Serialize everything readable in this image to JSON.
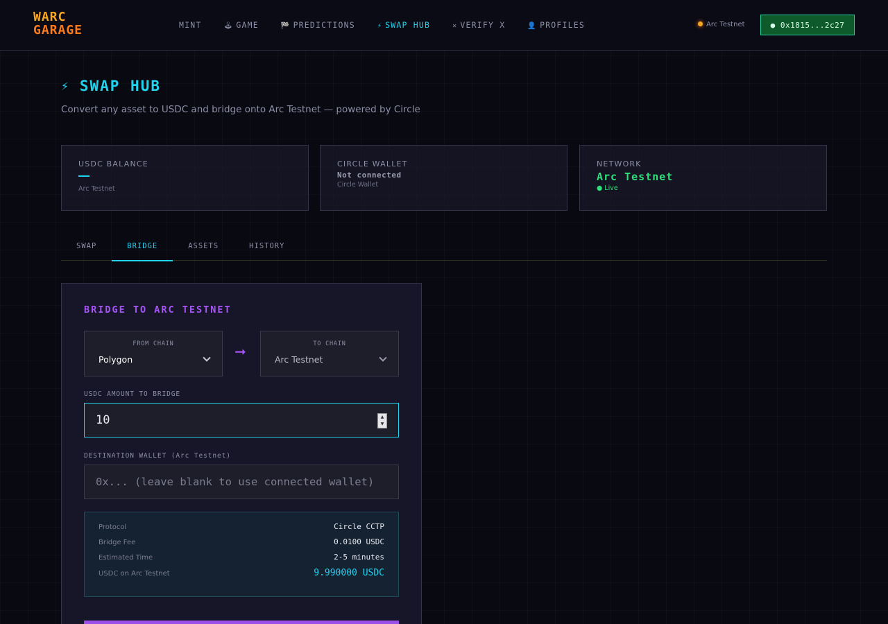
{
  "nav": {
    "logo_line1": "WARC",
    "logo_line2": "GARAGE",
    "items": [
      {
        "label": "MINT",
        "icon": ""
      },
      {
        "label": "GAME",
        "icon": "🕹"
      },
      {
        "label": "PREDICTIONS",
        "icon": "🏁"
      },
      {
        "label": "SWAP HUB",
        "icon": "⚡"
      },
      {
        "label": "VERIFY X",
        "icon": "✕"
      },
      {
        "label": "PROFILES",
        "icon": "👤"
      }
    ],
    "active": "SWAP HUB",
    "network_label": "Arc Testnet",
    "wallet_button": "● 0x1815...2c27"
  },
  "header": {
    "title": "SWAP HUB",
    "subtitle": "Convert any asset to USDC and bridge onto Arc Testnet — powered by Circle"
  },
  "stats": {
    "usdc": {
      "label": "USDC BALANCE",
      "sub": "Arc Testnet"
    },
    "circle": {
      "label": "CIRCLE WALLET",
      "value": "Not connected",
      "sub": "Circle Wallet"
    },
    "network": {
      "label": "NETWORK",
      "value": "Arc Testnet",
      "status": "● Live"
    }
  },
  "tabs": [
    "SWAP",
    "BRIDGE",
    "ASSETS",
    "HISTORY"
  ],
  "active_tab": "BRIDGE",
  "bridge": {
    "title": "BRIDGE TO ARC TESTNET",
    "from_label": "FROM CHAIN",
    "from_value": "Polygon",
    "to_label": "TO CHAIN",
    "to_value": "Arc Testnet",
    "amount_label": "USDC AMOUNT TO BRIDGE",
    "amount_value": "10",
    "dest_label": "DESTINATION WALLET (Arc Testnet)",
    "dest_placeholder": "0x... (leave blank to use connected wallet)",
    "info": [
      {
        "key": "Protocol",
        "value": "Circle CCTP"
      },
      {
        "key": "Bridge Fee",
        "value": "0.0100 USDC"
      },
      {
        "key": "Estimated Time",
        "value": "2-5 minutes"
      },
      {
        "key": "USDC on Arc Testnet",
        "value": "9.990000 USDC"
      }
    ]
  },
  "colors": {
    "accent": "#22d3ee",
    "purple": "#a855f7",
    "green": "#2ee07a",
    "orange": "#f5a623"
  }
}
